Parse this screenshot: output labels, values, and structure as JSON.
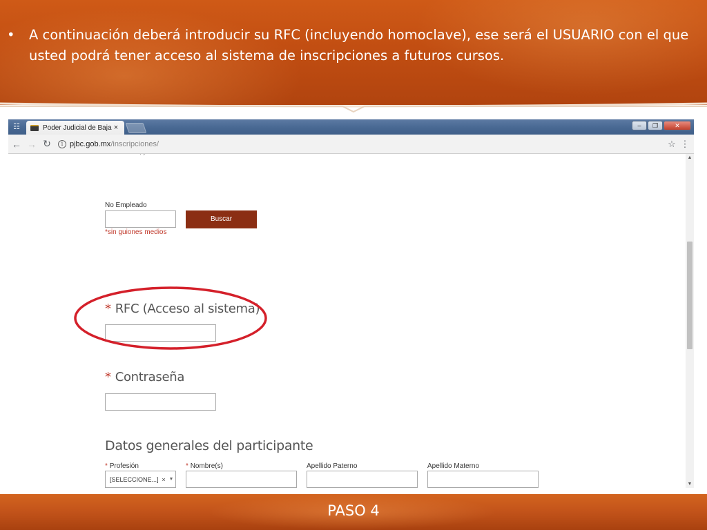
{
  "slide": {
    "bullet": "•",
    "header_text": "A continuación deberá introducir su RFC (incluyendo homoclave), ese será el USUARIO con el que usted podrá tener acceso al sistema de inscripciones a futuros cursos.",
    "footer_label": "PASO 4"
  },
  "browser": {
    "tab_title": "Poder Judicial de Baja Ca",
    "tab_close": "×",
    "url_domain": "pjbc.gob.mx",
    "url_path": "/inscripciones/",
    "back_icon": "arrow-left-icon",
    "forward_icon": "arrow-right-icon",
    "reload_icon": "reload-icon",
    "bookmark_icon": "star-icon",
    "menu_icon": "kebab-menu-icon"
  },
  "form": {
    "employee_label": "No Empleado",
    "search_button": "Buscar",
    "hint": "*sin guiones medios",
    "required_mark": "*",
    "rfc_label": "RFC (Acceso al sistema)",
    "password_label": "Contraseña",
    "section_title": "Datos generales del participante",
    "columns": {
      "profesion": "Profesión",
      "nombre": "Nombre(s)",
      "apellido_paterno": "Apellido Paterno",
      "apellido_materno": "Apellido Materno"
    },
    "profesion_value": "[SELECCIONE...]",
    "profesion_clear": "×"
  },
  "colors": {
    "slide_orange": "#c24e12",
    "button_brown": "#8b2e13",
    "required_red": "#c0392b",
    "highlight_ellipse": "#d4202a"
  }
}
